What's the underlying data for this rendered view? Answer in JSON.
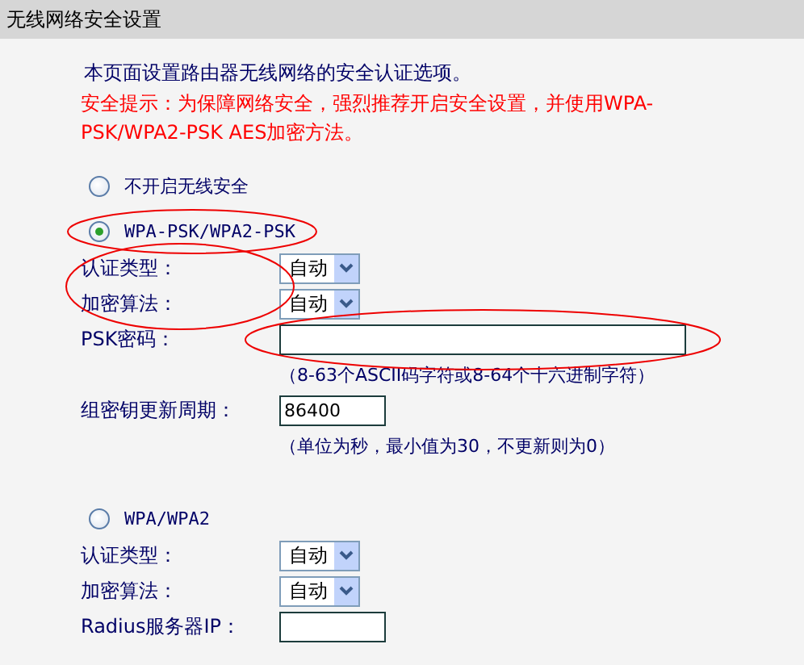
{
  "window": {
    "title": "无线网络安全设置"
  },
  "intro": "本页面设置路由器无线网络的安全认证选项。",
  "warning": "安全提示：为保障网络安全，强烈推荐开启安全设置，并使用WPA-PSK/WPA2-PSK AES加密方法。",
  "options": [
    {
      "label": "不开启无线安全",
      "selected": false
    },
    {
      "label": "WPA-PSK/WPA2-PSK",
      "selected": true,
      "circled": true,
      "labels_circled": true,
      "fields": [
        {
          "kind": "select",
          "label": "认证类型：",
          "value": "自动"
        },
        {
          "kind": "select",
          "label": "加密算法：",
          "value": "自动"
        },
        {
          "kind": "text",
          "label": "PSK密码：",
          "circled": true,
          "hint": "（8-63个ASCII码字符或8-64个十六进制字符）"
        },
        {
          "kind": "text",
          "label": "组密钥更新周期：",
          "value": "86400",
          "hint": "（单位为秒，最小值为30，不更新则为0）"
        }
      ]
    },
    {
      "label": "WPA/WPA2",
      "selected": false,
      "fields": [
        {
          "kind": "select",
          "label": "认证类型：",
          "value": "自动"
        },
        {
          "kind": "select",
          "label": "加密算法：",
          "value": "自动"
        },
        {
          "kind": "text",
          "label": "Radius服务器IP："
        }
      ]
    }
  ]
}
